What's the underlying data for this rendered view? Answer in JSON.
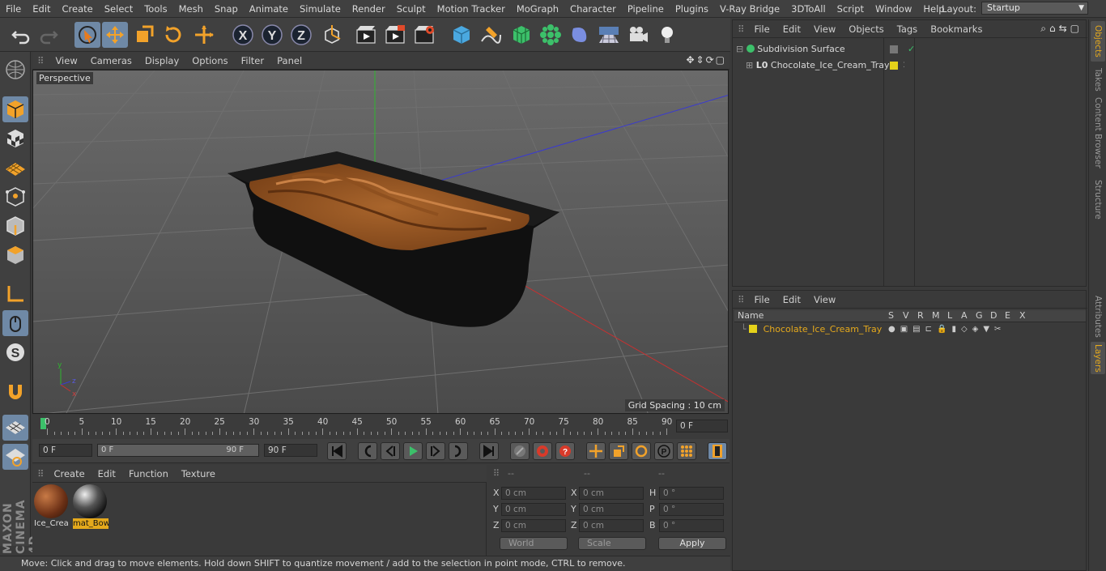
{
  "menubar": {
    "items": [
      "File",
      "Edit",
      "Create",
      "Select",
      "Tools",
      "Mesh",
      "Snap",
      "Animate",
      "Simulate",
      "Render",
      "Sculpt",
      "Motion Tracker",
      "MoGraph",
      "Character",
      "Pipeline",
      "Plugins",
      "V-Ray Bridge",
      "3DToAll",
      "Script",
      "Window",
      "Help"
    ],
    "layout_label": "Layout:",
    "layout_value": "Startup"
  },
  "toolbar": {
    "icons": [
      "undo-icon",
      "redo-icon",
      "live-selection-icon",
      "move-icon",
      "scale-icon",
      "rotate-icon",
      "transform-icon",
      "x-axis-icon",
      "y-axis-icon",
      "z-axis-icon",
      "coordinate-system-icon",
      "render-view-icon",
      "render-picture-viewer-icon",
      "edit-render-settings-icon",
      "cube-icon",
      "pen-spline-icon",
      "subdivision-icon",
      "cloner-icon",
      "deformer-icon",
      "floor-icon",
      "camera-icon",
      "light-icon"
    ]
  },
  "left_toolbar": {
    "icons": [
      "make-editable-icon",
      "model-mode-icon",
      "texture-mode-icon",
      "workplane-icon",
      "points-mode-icon",
      "edges-mode-icon",
      "polygons-mode-icon",
      "axis-mode-icon",
      "tweak-mode-icon",
      "solo-icon",
      "snap-icon",
      "lock-workplane-icon",
      "planar-workplane-icon"
    ],
    "brand": "MAXON CINEMA 4D"
  },
  "viewport": {
    "menu": [
      "View",
      "Cameras",
      "Display",
      "Options",
      "Filter",
      "Panel"
    ],
    "label": "Perspective",
    "grid_spacing": "Grid Spacing : 10 cm"
  },
  "timeline": {
    "ticks": [
      "0",
      "5",
      "10",
      "15",
      "20",
      "25",
      "30",
      "35",
      "40",
      "45",
      "50",
      "55",
      "60",
      "65",
      "70",
      "75",
      "80",
      "85",
      "90"
    ],
    "current_frame": "0 F",
    "start_frame": "0 F",
    "range_start": "0 F",
    "range_end": "90 F",
    "end_frame": "90 F"
  },
  "material_manager": {
    "menu": [
      "Create",
      "Edit",
      "Function",
      "Texture"
    ],
    "materials": [
      {
        "name": "Ice_Crea",
        "selected": false
      },
      {
        "name": "mat_Bow",
        "selected": true
      }
    ]
  },
  "coordinates": {
    "headers": [
      "--",
      "--",
      "--"
    ],
    "rows": [
      {
        "a": "X",
        "av": "0 cm",
        "b": "X",
        "bv": "0 cm",
        "c": "H",
        "cv": "0 °"
      },
      {
        "a": "Y",
        "av": "0 cm",
        "b": "Y",
        "bv": "0 cm",
        "c": "P",
        "cv": "0 °"
      },
      {
        "a": "Z",
        "av": "0 cm",
        "b": "Z",
        "bv": "0 cm",
        "c": "B",
        "cv": "0 °"
      }
    ],
    "world": "World",
    "scale": "Scale",
    "apply": "Apply"
  },
  "status": "Move: Click and drag to move elements. Hold down SHIFT to quantize movement / add to the selection in point mode, CTRL to remove.",
  "object_manager": {
    "menu": [
      "File",
      "Edit",
      "View",
      "Objects",
      "Tags",
      "Bookmarks"
    ],
    "objects": [
      {
        "name": "Subdivision Surface"
      },
      {
        "name": "Chocolate_Ice_Cream_Tray"
      }
    ]
  },
  "layer_manager": {
    "menu": [
      "File",
      "Edit",
      "View"
    ],
    "columns": [
      "Name",
      "S",
      "V",
      "R",
      "M",
      "L",
      "A",
      "G",
      "D",
      "E",
      "X"
    ],
    "layers": [
      {
        "name": "Chocolate_Ice_Cream_Tray",
        "color": "#e5d21a"
      }
    ]
  },
  "right_tabs": [
    "Objects",
    "Takes",
    "Content Browser",
    "Structure",
    "Attributes",
    "Layers"
  ],
  "colors": {
    "accent": "#e5a91c",
    "selected_tool": "#6f89a6"
  }
}
